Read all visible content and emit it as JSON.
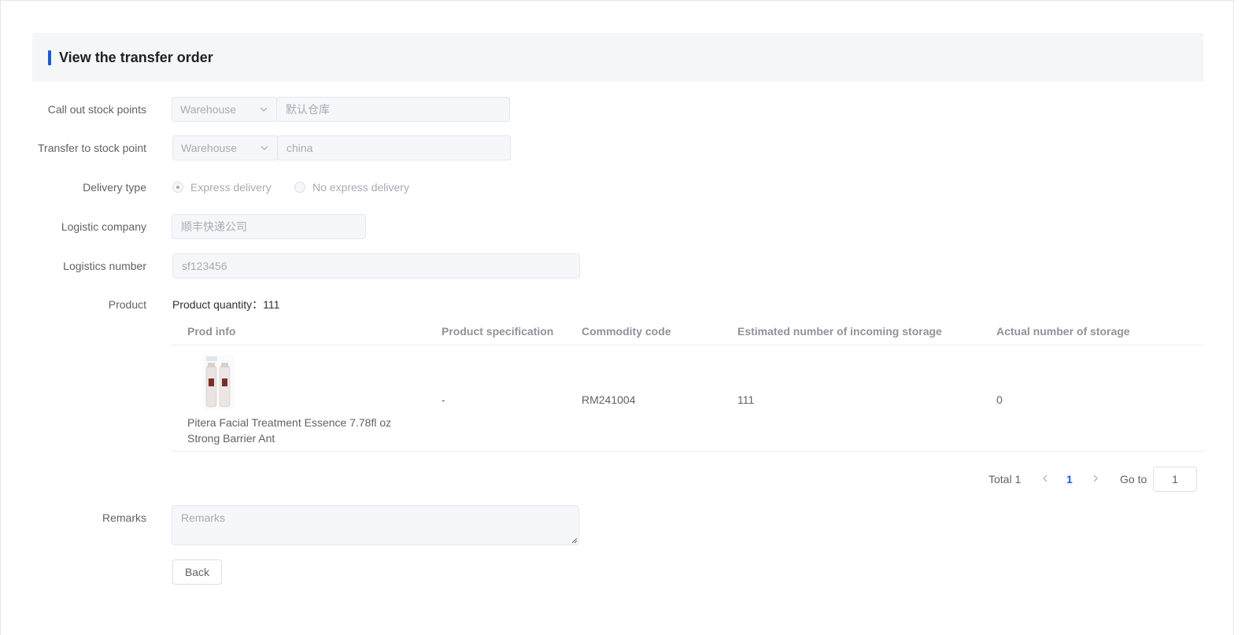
{
  "header": {
    "title": "View the transfer order"
  },
  "form": {
    "call_out": {
      "label": "Call out stock points",
      "type_value": "Warehouse",
      "name_value": "默认仓库"
    },
    "transfer_to": {
      "label": "Transfer to stock point",
      "type_value": "Warehouse",
      "name_value": "china"
    },
    "delivery": {
      "label": "Delivery type",
      "options": [
        "Express delivery",
        "No express delivery"
      ],
      "selected": "Express delivery"
    },
    "logistic_company": {
      "label": "Logistic company",
      "value": "顺丰快递公司"
    },
    "logistics_number": {
      "label": "Logistics number",
      "value": "sf123456"
    },
    "product": {
      "label": "Product",
      "quantity_text": "Product quantity：111"
    },
    "remarks": {
      "label": "Remarks",
      "placeholder": "Remarks"
    },
    "back_label": "Back"
  },
  "table": {
    "columns": [
      "Prod info",
      "Product specification",
      "Commodity code",
      "Estimated number of incoming storage",
      "Actual number of storage"
    ],
    "rows": [
      {
        "name": "Pitera Facial Treatment Essence 7.78fl oz Strong Barrier Ant",
        "spec": "-",
        "code": "RM241004",
        "estimated": "111",
        "actual": "0"
      }
    ]
  },
  "pagination": {
    "total_text": "Total 1",
    "current": "1",
    "goto_label": "Go to",
    "goto_value": "1"
  },
  "colors": {
    "accent": "#1a5bd6",
    "header_bg": "#f5f6f8",
    "input_bg": "#f5f7fa"
  },
  "icons": [
    "chevron-down-icon",
    "chevron-left-icon",
    "chevron-right-icon",
    "resize-grip-icon"
  ]
}
